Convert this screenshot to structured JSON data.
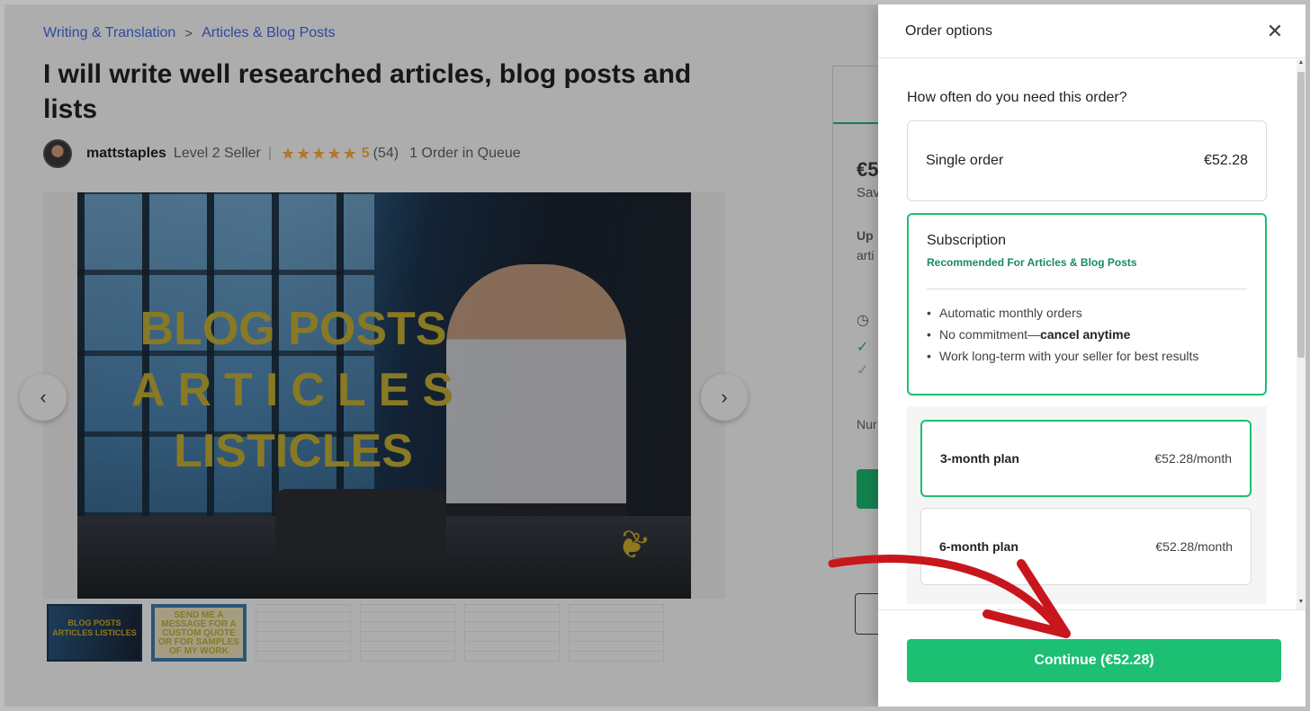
{
  "breadcrumb": {
    "level1": "Writing & Translation",
    "level2": "Articles & Blog Posts",
    "separator": ">"
  },
  "gig": {
    "title": "I will write well researched articles, blog posts and lists"
  },
  "seller": {
    "name": "mattstaples",
    "level": "Level 2 Seller",
    "divider": "|",
    "stars": "★★★★★",
    "rating": "5",
    "review_count": "(54)",
    "queue": "1 Order in Queue"
  },
  "hero_image": {
    "line1": "BLOG POSTS",
    "line2": "ARTICLES",
    "line3": "LISTICLES"
  },
  "gallery": {
    "prev_icon": "‹",
    "next_icon": "›"
  },
  "thumbnails": {
    "t1": "BLOG POSTS ARTICLES LISTICLES",
    "t2": "SEND ME A MESSAGE FOR A CUSTOM QUOTE OR FOR SAMPLES OF MY WORK"
  },
  "side_card": {
    "price_peek": "€5",
    "save_peek": "Sav",
    "line_up": "Up",
    "line_arti": "arti",
    "line_num": "Nur"
  },
  "drawer": {
    "title": "Order options",
    "close_icon": "✕",
    "question": "How often do you need this order?",
    "single": {
      "label": "Single order",
      "price": "€52.28"
    },
    "subscription": {
      "label": "Subscription",
      "recommended": "Recommended For Articles & Blog Posts",
      "bullets": {
        "b1": "Automatic monthly orders",
        "b2_pre": "No commitment—",
        "b2_bold": "cancel anytime",
        "b3": "Work long-term with your seller for best results"
      }
    },
    "plans": [
      {
        "label": "3-month plan",
        "price": "€52.28/month",
        "selected": true
      },
      {
        "label": "6-month plan",
        "price": "€52.28/month",
        "selected": false
      }
    ],
    "continue_label": "Continue (€52.28)"
  },
  "colors": {
    "accent": "#1dbf73",
    "link": "#446ee7",
    "star": "#ffb33e",
    "annotation_arrow": "#c8161d"
  }
}
